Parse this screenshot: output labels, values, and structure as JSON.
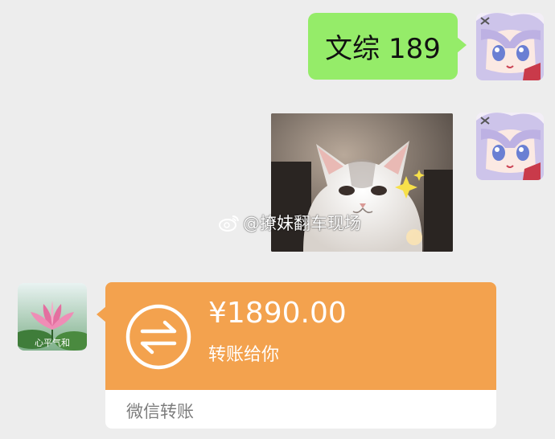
{
  "messages": {
    "text_message": "文综 189",
    "sticker_alt": "white cat sticker"
  },
  "watermark": {
    "text": "@撩妹翻车现场",
    "icon": "weibo-icon"
  },
  "other_avatar": {
    "caption": "心平气和"
  },
  "transfer": {
    "amount": "¥1890.00",
    "note": "转账给你",
    "footer": "微信转账",
    "icon": "transfer-arrows-icon"
  },
  "colors": {
    "background": "#ededed",
    "sent_bubble": "#95ec69",
    "transfer_orange": "#f3a24e",
    "footer_text": "#7d7d7d"
  }
}
